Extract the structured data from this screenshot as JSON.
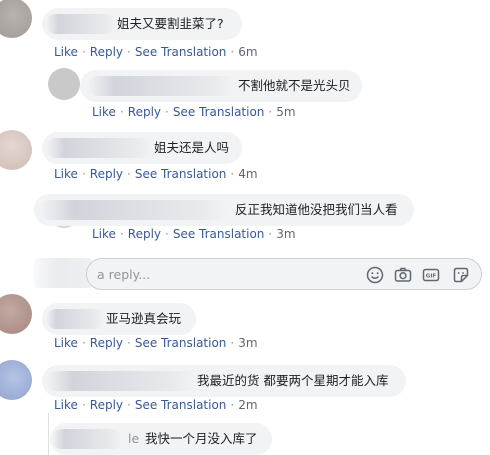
{
  "comments": [
    {
      "text": "姐夫又要割韭菜了?",
      "actions": [
        "Like",
        "Reply",
        "See Translation"
      ],
      "time": "6m"
    },
    {
      "text": "不割他就不是光头贝",
      "actions": [
        "Like",
        "Reply",
        "See Translation"
      ],
      "time": "5m"
    },
    {
      "text": "姐夫还是人吗",
      "actions": [
        "Like",
        "Reply",
        "See Translation"
      ],
      "time": "4m"
    },
    {
      "text": "反正我知道他没把我们当人看",
      "actions": [
        "Like",
        "Reply",
        "See Translation"
      ],
      "time": "3m"
    },
    {
      "text": "亚马逊真会玩",
      "actions": [
        "Like",
        "Reply",
        "See Translation"
      ],
      "time": "3m"
    },
    {
      "text": "我最近的货 都要两个星期才能入库",
      "actions": [
        "Like",
        "Reply",
        "See Translation"
      ],
      "time": "2m"
    },
    {
      "partial_name": "le",
      "text": "我快一个月没入库了"
    }
  ],
  "reply_box": {
    "placeholder": "a reply...",
    "icons": [
      "emoji-icon",
      "camera-icon",
      "gif-icon",
      "sticker-icon"
    ]
  },
  "colors": {
    "link": "#385898",
    "bubble": "#f2f3f5",
    "meta": "#606770"
  }
}
